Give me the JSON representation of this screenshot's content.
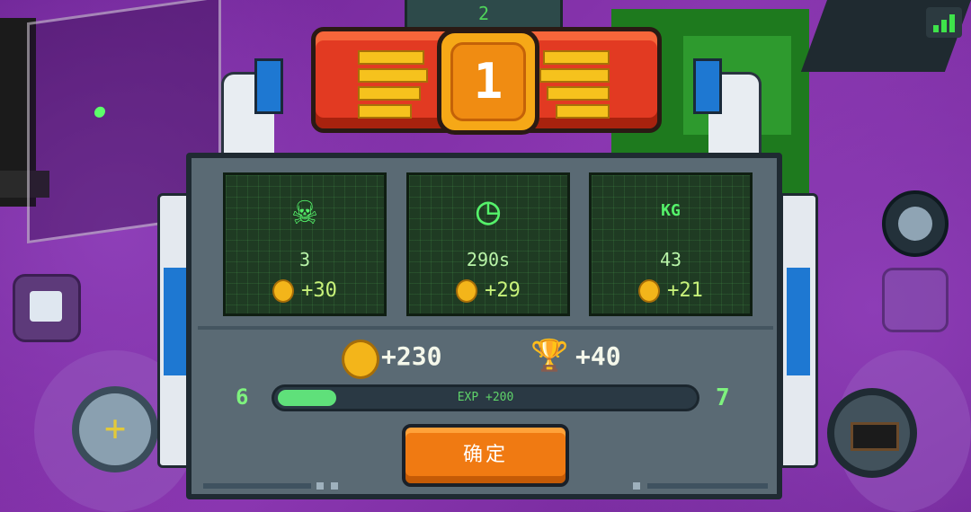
{
  "hud": {
    "top_counter": "2",
    "signal_icon": "signal-bars-icon"
  },
  "result": {
    "rank": "1",
    "stats": [
      {
        "icon": "skull-icon",
        "value": "3",
        "reward": "+30"
      },
      {
        "icon": "clock-icon",
        "value": "290s",
        "reward": "+29"
      },
      {
        "icon": "weight-icon",
        "icon_text": "KG",
        "value": "43",
        "reward": "+21"
      }
    ],
    "total_coins": "+230",
    "total_trophies": "+40",
    "level_from": "6",
    "level_to": "7",
    "exp_label": "EXP +200",
    "exp_progress": 0.14,
    "confirm_label": "确定"
  },
  "colors": {
    "accent_green": "#5fe07a",
    "confirm_orange": "#f07a12",
    "banner_red": "#e23a22",
    "coin_gold": "#f3b51a"
  }
}
